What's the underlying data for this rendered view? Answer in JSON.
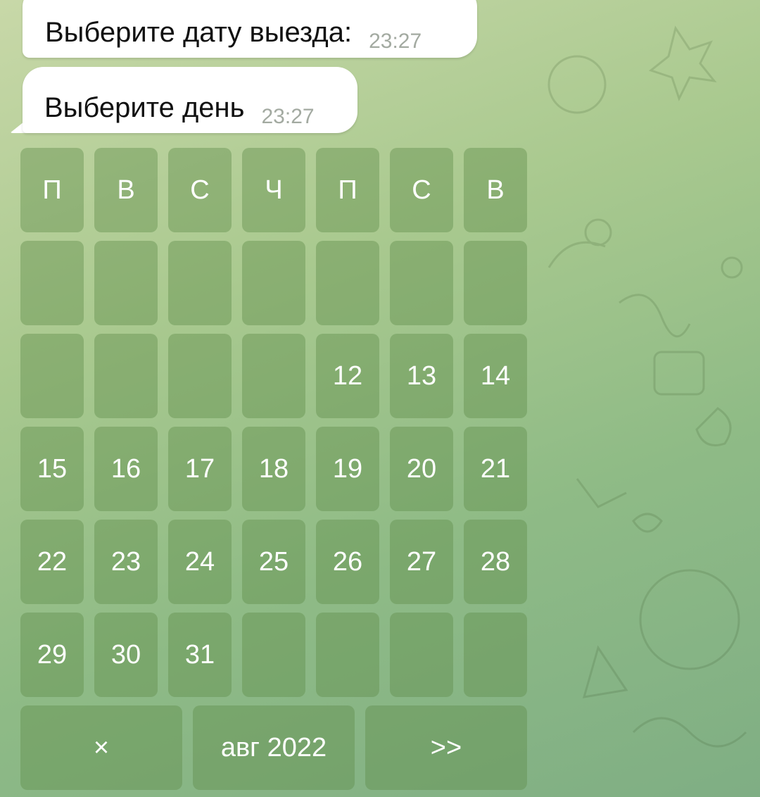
{
  "messages": [
    {
      "text": "Выберите дату выезда:",
      "time": "23:27"
    },
    {
      "text": "Выберите день",
      "time": "23:27"
    }
  ],
  "calendar": {
    "weekdays": [
      "П",
      "В",
      "С",
      "Ч",
      "П",
      "С",
      "В"
    ],
    "weeks": [
      [
        "",
        "",
        "",
        "",
        "",
        "",
        ""
      ],
      [
        "",
        "",
        "",
        "",
        "12",
        "13",
        "14"
      ],
      [
        "15",
        "16",
        "17",
        "18",
        "19",
        "20",
        "21"
      ],
      [
        "22",
        "23",
        "24",
        "25",
        "26",
        "27",
        "28"
      ],
      [
        "29",
        "30",
        "31",
        "",
        "",
        "",
        ""
      ]
    ],
    "nav": {
      "close": "×",
      "month": "авг 2022",
      "next": ">>"
    }
  },
  "colors": {
    "button_bg": "#6f9a5c",
    "bubble_bg": "#ffffff",
    "time_text": "#a3aaa1"
  }
}
